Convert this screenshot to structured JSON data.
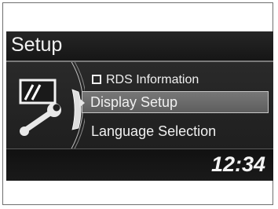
{
  "header": {
    "title": "Setup"
  },
  "menu": {
    "items": [
      {
        "label": "RDS Information",
        "checked": false
      },
      {
        "label": "Display Setup",
        "selected": true
      },
      {
        "label": "Language Selection"
      }
    ]
  },
  "status": {
    "clock": "12:34"
  },
  "icons": {
    "display": "display-icon",
    "wrench": "wrench-icon",
    "checkbox": "checkbox-icon",
    "pointer": "selection-arrow-icon"
  }
}
